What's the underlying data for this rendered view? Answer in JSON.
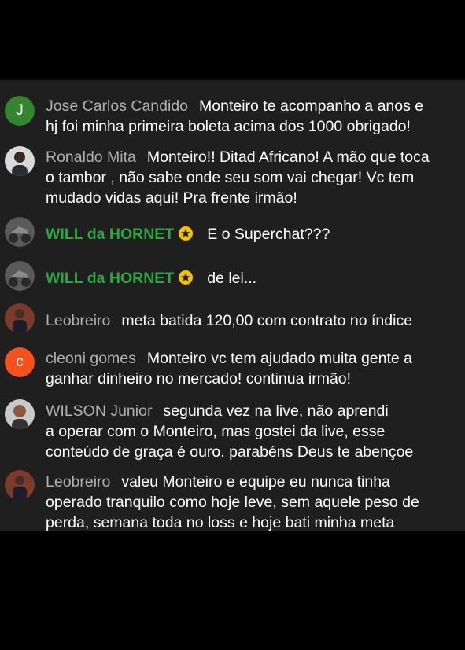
{
  "colors": {
    "background": "#000000",
    "chat_background": "#1f1f1f",
    "author_name": "#b0b0b0",
    "member_name": "#2ba640",
    "badge": "#f2c200",
    "avatar_j": "#33862f",
    "avatar_c": "#f4511e"
  },
  "messages": [
    {
      "author": "Jose Carlos Candido",
      "avatar": {
        "type": "letter",
        "letter": "J"
      },
      "lines": [
        "Monteiro te acompanho a anos e",
        "hj foi minha primeira boleta acima dos 1000 obrigado!"
      ]
    },
    {
      "author": "Ronaldo Mita",
      "avatar": {
        "type": "photo",
        "icon": "person-photo-icon"
      },
      "lines": [
        "Monteiro!! Ditad Africano! A mão que toca",
        "o tambor , não sabe onde seu som vai chegar! Vc tem",
        "mudado vidas aqui! Pra frente irmão!"
      ]
    },
    {
      "author": "WILL da HORNET",
      "member": true,
      "badge_icon": "star-badge-icon",
      "avatar": {
        "type": "photo",
        "icon": "motorcycle-photo-icon"
      },
      "lines": [
        "E o Superchat???"
      ]
    },
    {
      "author": "WILL da HORNET",
      "member": true,
      "badge_icon": "star-badge-icon",
      "avatar": {
        "type": "photo",
        "icon": "motorcycle-photo-icon"
      },
      "lines": [
        "de lei..."
      ]
    },
    {
      "author": "Leobreiro",
      "avatar": {
        "type": "photo",
        "icon": "person-photo-icon"
      },
      "lines": [
        "meta batida 120,00 com contrato no índice"
      ]
    },
    {
      "author": "cleoni gomes",
      "avatar": {
        "type": "letter",
        "letter": "c"
      },
      "lines": [
        "Monteiro vc tem ajudado muita gente a",
        "ganhar dinheiro no mercado! continua irmão!"
      ]
    },
    {
      "author": "WILSON Junior",
      "avatar": {
        "type": "photo",
        "icon": "person-photo-icon"
      },
      "lines": [
        "segunda vez na live, não aprendi",
        "a operar com o Monteiro, mas gostei da live, esse",
        "conteúdo de graça é ouro. parabéns Deus te abençoe"
      ]
    },
    {
      "author": "Leobreiro",
      "avatar": {
        "type": "photo",
        "icon": "person-photo-icon"
      },
      "lines": [
        "valeu Monteiro e equipe eu nunca tinha",
        "operado tranquilo como hoje leve, sem aquele peso de",
        "perda, semana toda no loss e hoje bati minha meta"
      ]
    }
  ]
}
